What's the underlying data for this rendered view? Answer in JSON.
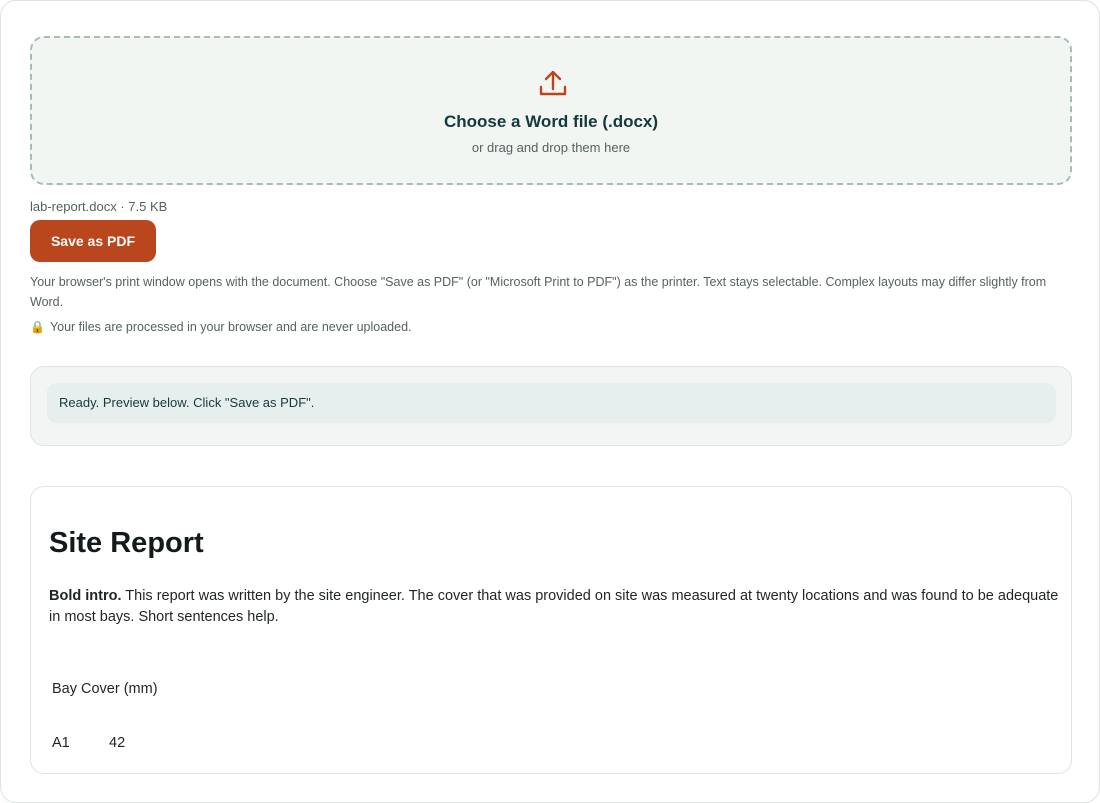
{
  "dropzone": {
    "icon": "upload-icon",
    "title": "Choose a Word file (.docx)",
    "subtitle": "or drag and drop them here"
  },
  "file": {
    "info": "lab-report.docx · 7.5 KB"
  },
  "actions": {
    "save_pdf_label": "Save as PDF"
  },
  "help": {
    "text": "Your browser's print window opens with the document. Choose \"Save as PDF\" (or \"Microsoft Print to PDF\") as the printer. Text stays selectable. Complex layouts may differ slightly from Word.",
    "privacy_icon": "lock-icon",
    "privacy_text": "Your files are processed in your browser and are never uploaded."
  },
  "status": {
    "message": "Ready. Preview below. Click \"Save as PDF\"."
  },
  "preview": {
    "title": "Site Report",
    "para_bold": "Bold intro.",
    "para_text": " This report was written by the site engineer. The cover that was provided on site was measured at twenty locations and was found to be adequate in most bays. Short sentences help.",
    "table": {
      "header": [
        "Bay Cover (mm)"
      ],
      "rows": [
        [
          "A1",
          "42"
        ]
      ]
    }
  },
  "colors": {
    "accent": "#b9461c",
    "heading": "#14383d",
    "dropzone_bg": "#f2f6f3",
    "status_bg": "#e6eeee"
  }
}
